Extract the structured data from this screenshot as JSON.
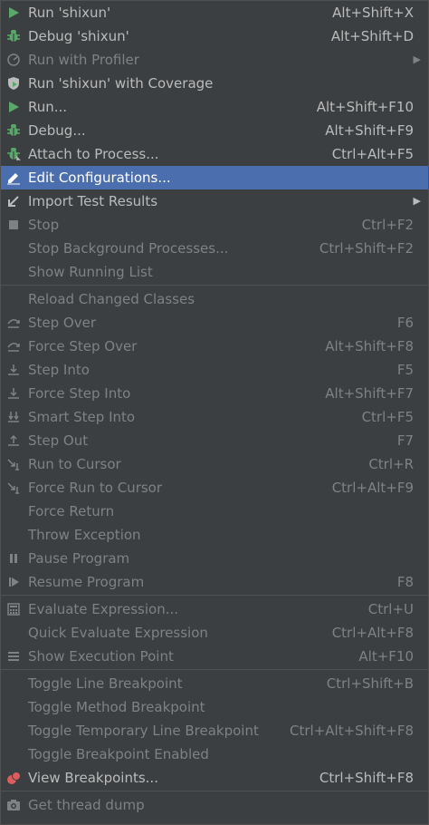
{
  "colors": {
    "background": "#3c3f41",
    "selected_background": "#4b6eaf",
    "enabled_text": "#bbbbbb",
    "disabled_text": "#7f8183",
    "run_green": "#59a869",
    "debug_red": "#db5c5c"
  },
  "menu": {
    "items": [
      {
        "icon": "run-icon",
        "label": "Run 'shixun'",
        "shortcut": "Alt+Shift+X",
        "enabled": true
      },
      {
        "icon": "debug-bug-icon",
        "label": "Debug 'shixun'",
        "shortcut": "Alt+Shift+D",
        "enabled": true
      },
      {
        "icon": "profiler-icon",
        "label": "Run with Profiler",
        "shortcut": "",
        "enabled": false,
        "submenu": true
      },
      {
        "icon": "coverage-shield-icon",
        "label": "Run 'shixun' with Coverage",
        "shortcut": "",
        "enabled": true
      },
      {
        "icon": "run-icon",
        "label": "Run...",
        "shortcut": "Alt+Shift+F10",
        "enabled": true
      },
      {
        "icon": "debug-bug-icon",
        "label": "Debug...",
        "shortcut": "Alt+Shift+F9",
        "enabled": true
      },
      {
        "icon": "attach-bug-icon",
        "label": "Attach to Process...",
        "shortcut": "Ctrl+Alt+F5",
        "enabled": true
      },
      {
        "icon": "pencil-edit-icon",
        "label": "Edit Configurations...",
        "shortcut": "",
        "enabled": true,
        "selected": true
      },
      {
        "icon": "import-arrow-icon",
        "label": "Import Test Results",
        "shortcut": "",
        "enabled": true,
        "submenu": true
      },
      {
        "icon": "stop-square-icon",
        "label": "Stop",
        "shortcut": "Ctrl+F2",
        "enabled": false
      },
      {
        "icon": "",
        "label": "Stop Background Processes...",
        "shortcut": "Ctrl+Shift+F2",
        "enabled": false
      },
      {
        "icon": "",
        "label": "Show Running List",
        "shortcut": "",
        "enabled": false
      },
      {
        "separator": true
      },
      {
        "icon": "",
        "label": "Reload Changed Classes",
        "shortcut": "",
        "enabled": false
      },
      {
        "icon": "step-over-icon",
        "label": "Step Over",
        "shortcut": "F6",
        "enabled": false
      },
      {
        "icon": "force-step-over-icon",
        "label": "Force Step Over",
        "shortcut": "Alt+Shift+F8",
        "enabled": false
      },
      {
        "icon": "step-into-icon",
        "label": "Step Into",
        "shortcut": "F5",
        "enabled": false
      },
      {
        "icon": "force-step-into-icon",
        "label": "Force Step Into",
        "shortcut": "Alt+Shift+F7",
        "enabled": false
      },
      {
        "icon": "smart-step-into-icon",
        "label": "Smart Step Into",
        "shortcut": "Ctrl+F5",
        "enabled": false
      },
      {
        "icon": "step-out-icon",
        "label": "Step Out",
        "shortcut": "F7",
        "enabled": false
      },
      {
        "icon": "run-to-cursor-icon",
        "label": "Run to Cursor",
        "shortcut": "Ctrl+R",
        "enabled": false
      },
      {
        "icon": "force-run-to-cursor-icon",
        "label": "Force Run to Cursor",
        "shortcut": "Ctrl+Alt+F9",
        "enabled": false
      },
      {
        "icon": "",
        "label": "Force Return",
        "shortcut": "",
        "enabled": false
      },
      {
        "icon": "",
        "label": "Throw Exception",
        "shortcut": "",
        "enabled": false
      },
      {
        "icon": "pause-icon",
        "label": "Pause Program",
        "shortcut": "",
        "enabled": false
      },
      {
        "icon": "resume-icon",
        "label": "Resume Program",
        "shortcut": "F8",
        "enabled": false
      },
      {
        "separator": true
      },
      {
        "icon": "calculator-icon",
        "label": "Evaluate Expression...",
        "shortcut": "Ctrl+U",
        "enabled": false
      },
      {
        "icon": "",
        "label": "Quick Evaluate Expression",
        "shortcut": "Ctrl+Alt+F8",
        "enabled": false
      },
      {
        "icon": "execution-point-icon",
        "label": "Show Execution Point",
        "shortcut": "Alt+F10",
        "enabled": false
      },
      {
        "separator": true
      },
      {
        "icon": "",
        "label": "Toggle Line Breakpoint",
        "shortcut": "Ctrl+Shift+B",
        "enabled": false
      },
      {
        "icon": "",
        "label": "Toggle Method Breakpoint",
        "shortcut": "",
        "enabled": false
      },
      {
        "icon": "",
        "label": "Toggle Temporary Line Breakpoint",
        "shortcut": "Ctrl+Alt+Shift+F8",
        "enabled": false
      },
      {
        "icon": "",
        "label": "Toggle Breakpoint Enabled",
        "shortcut": "",
        "enabled": false
      },
      {
        "icon": "breakpoints-icon",
        "label": "View Breakpoints...",
        "shortcut": "Ctrl+Shift+F8",
        "enabled": true
      },
      {
        "separator": true
      },
      {
        "icon": "camera-icon",
        "label": "Get thread dump",
        "shortcut": "",
        "enabled": false
      }
    ]
  }
}
